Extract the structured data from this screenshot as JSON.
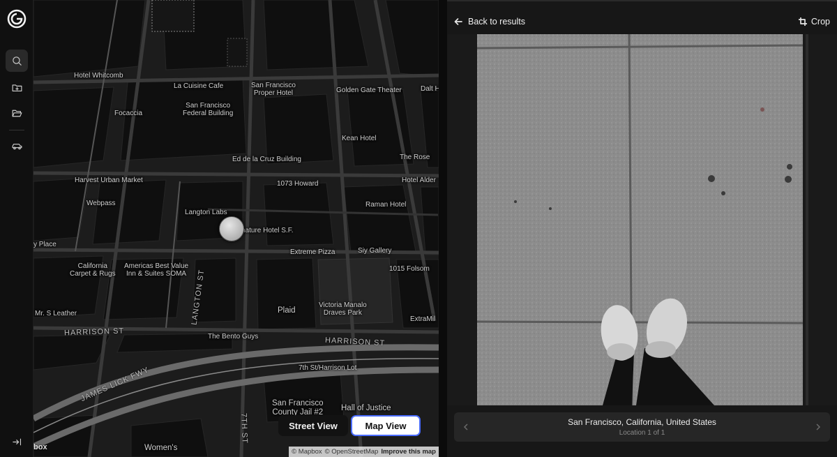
{
  "sidebar": {
    "logo_icon": "g-logo-icon",
    "items": [
      {
        "icon": "search-icon",
        "active": true
      },
      {
        "icon": "folder-plus-icon",
        "active": false
      },
      {
        "icon": "folder-open-icon",
        "active": false
      },
      {
        "icon": "car-icon",
        "active": false
      }
    ],
    "collapse_icon": "collapse-sidebar-icon"
  },
  "map": {
    "labels": {
      "hotel_whitcomb": "Hotel Whitcomb",
      "la_cuisine": "La Cuisine Cafe",
      "sf_proper": "San Francisco\nProper Hotel",
      "golden_gate_theater": "Golden Gate Theater",
      "dalt_ho": "Dalt Ho",
      "focaccia": "Focaccia",
      "sf_federal": "San Francisco\nFederal Building",
      "kean_hotel": "Kean Hotel",
      "ed_dela_cruz": "Ed de la Cruz Building",
      "the_rose": "The Rose",
      "harvest_urban": "Harvest Urban Market",
      "howard_1073": "1073 Howard",
      "hotel_alder": "Hotel Alder",
      "webpass": "Webpass",
      "raman_hotel": "Raman Hotel",
      "langton_labs": "Langton Labs",
      "nature_hotel": "nature Hotel S.F.",
      "y_place": "y Place",
      "extreme_pizza": "Extreme Pizza",
      "siy_gallery": "Siy Gallery",
      "california_carpet": "California\nCarpet & Rugs",
      "americas_best": "Americas Best Value\nInn & Suites SOMA",
      "folsom_1015": "1015 Folsom",
      "plaid": "Plaid",
      "victoria_manalo": "Victoria Manalo\nDraves Park",
      "mr_s_leather": "Mr. S Leather",
      "extramile": "ExtraMil",
      "bento_guys": "The Bento Guys",
      "seventh_harrison": "7th St/Harrison Lot",
      "sf_county_jail": "San Francisco\nCounty Jail #2",
      "hall_of_justice": "Hall of Justice",
      "womens": "Women's"
    },
    "streets": {
      "harrison_w": "HARRISON ST",
      "harrison_e": "HARRISON ST",
      "langton": "LANGTON ST",
      "james_lick": "JAMES LICK FWY",
      "seventh": "7TH ST"
    },
    "toggle": {
      "street_view": "Street View",
      "map_view": "Map View"
    },
    "attribution": {
      "mapbox": "© Mapbox",
      "osm": "© OpenStreetMap",
      "improve": "Improve this map"
    },
    "logo_text": "box"
  },
  "pane": {
    "back_label": "Back to results",
    "crop_label": "Crop",
    "location": {
      "title": "San Francisco, California, United States",
      "subtitle": "Location 1 of 1"
    }
  }
}
